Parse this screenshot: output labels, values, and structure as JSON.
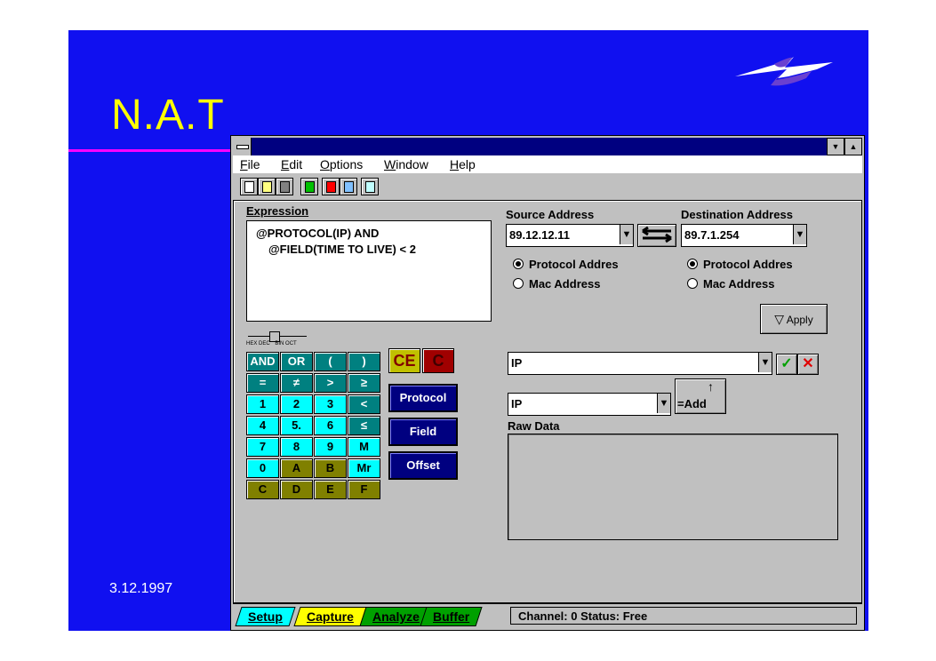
{
  "slide": {
    "title": "N.A.T",
    "date": "3.12.1997"
  },
  "window": {
    "menu": [
      "File",
      "Edit",
      "Options",
      "Window",
      "Help"
    ],
    "scroll_down": "▼",
    "scroll_up": "▲"
  },
  "expression": {
    "label": "Expression",
    "lines": [
      "@PROTOCOL(IP)  AND",
      "@FIELD(TIME TO LIVE) < 2"
    ]
  },
  "radix": [
    "HEX",
    "DEC",
    "BIN",
    "OCT"
  ],
  "keypad": [
    [
      "AND",
      "OR",
      "(",
      ")"
    ],
    [
      "=",
      "≠",
      ">",
      "≥"
    ],
    [
      "1",
      "2",
      "3",
      "<"
    ],
    [
      "4",
      "5.",
      "6",
      "≤"
    ],
    [
      "7",
      "8",
      "9",
      "M"
    ],
    [
      "0",
      "A",
      "B",
      "Mr"
    ],
    [
      "C",
      "D",
      "E",
      "F"
    ]
  ],
  "ce_label": "CE",
  "c_label": "C",
  "buttons": {
    "protocol": "Protocol",
    "field": "Field",
    "offset": "Offset",
    "apply": "Apply",
    "add": "=Add"
  },
  "source": {
    "label": "Source Address",
    "value": "89.12.12.11",
    "opt1": "Protocol Addres",
    "opt2": "Mac Address"
  },
  "destination": {
    "label": "Destination Address",
    "value": "89.7.1.254",
    "opt1": "Protocol Addres",
    "opt2": "Mac Address"
  },
  "combo1": "IP",
  "combo2": "IP",
  "raw_data_label": "Raw Data",
  "tabs": [
    "Setup",
    "Capture",
    "Analyze",
    "Buffer"
  ],
  "status": "Channel: 0  Status: Free",
  "colors": {
    "slide_bg": "#1010f0",
    "title": "#ffff00",
    "accent_line": "#ff00ff",
    "titlebar": "#000080",
    "window_bg": "#c0c0c0"
  },
  "icons": [
    "logo-swoosh",
    "new-file-icon",
    "open-folder-icon",
    "save-disk-icon",
    "filter-icon",
    "check-icon",
    "cross-icon",
    "swap-arrows-icon"
  ]
}
